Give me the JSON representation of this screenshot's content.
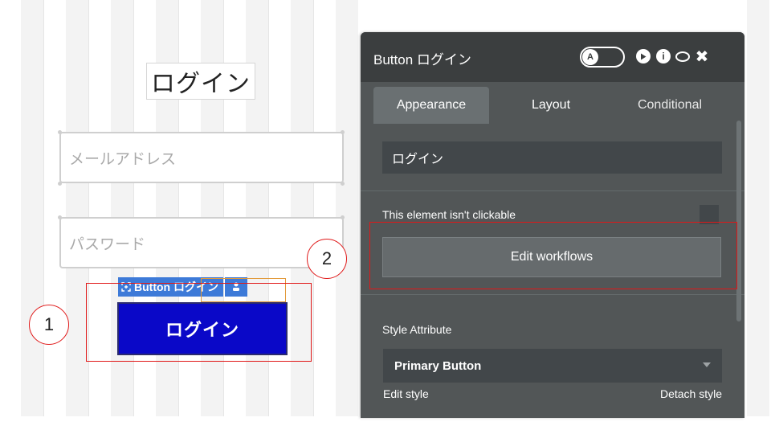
{
  "canvas": {
    "title": "ログイン",
    "email_placeholder": "メールアドレス",
    "password_placeholder": "パスワード",
    "selected_tag_label": "Button ログイン",
    "selected_tag_icon": "crosshair-icon",
    "button_label": "ログイン",
    "callout_1": "1",
    "callout_2": "2",
    "button_color": "#0a08c8",
    "highlight_color": "#e01818"
  },
  "panel": {
    "title": "Button ログイン",
    "tabs": [
      {
        "label": "Appearance",
        "active": true
      },
      {
        "label": "Layout",
        "active": false
      },
      {
        "label": "Conditional",
        "active": false
      }
    ],
    "text_value": "ログイン",
    "clickable_label": "This element isn't clickable",
    "edit_workflows_label": "Edit workflows",
    "style_attribute_label": "Style Attribute",
    "style_selected": "Primary Button",
    "edit_style_label": "Edit style",
    "detach_style_label": "Detach style",
    "header_icons": [
      "toggle-icon",
      "play-icon",
      "info-icon",
      "comment-icon",
      "close-icon"
    ],
    "toggle_glyph": "A",
    "info_glyph": "i",
    "close_glyph": "✖"
  }
}
